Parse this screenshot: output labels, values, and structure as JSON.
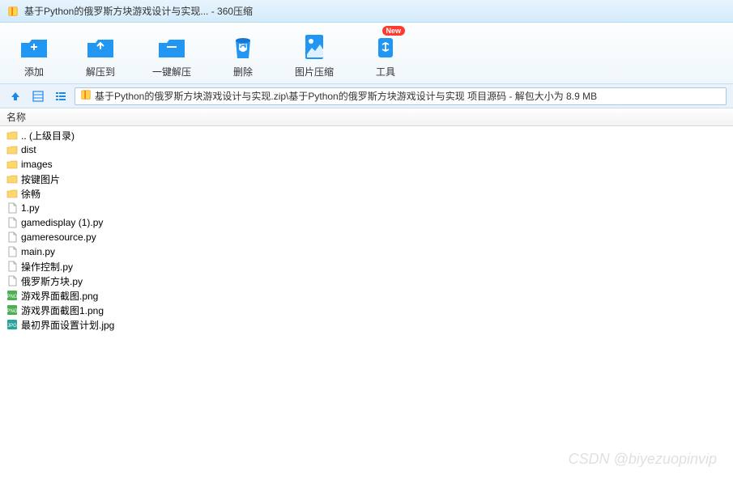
{
  "titlebar": {
    "title": "基于Python的俄罗斯方块游戏设计与实现... - 360压缩"
  },
  "toolbar": {
    "add": "添加",
    "extract_to": "解压到",
    "one_click_extract": "一键解压",
    "delete": "删除",
    "image_compress": "图片压缩",
    "tools": "工具",
    "new_badge": "New"
  },
  "pathbar": {
    "path_text": "基于Python的俄罗斯方块游戏设计与实现.zip\\基于Python的俄罗斯方块游戏设计与实现 项目源码 - 解包大小为 8.9 MB"
  },
  "columns": {
    "name": "名称"
  },
  "files": [
    {
      "icon": "folder-up",
      "name": ".. (上级目录)"
    },
    {
      "icon": "folder",
      "name": "dist"
    },
    {
      "icon": "folder",
      "name": "images"
    },
    {
      "icon": "folder",
      "name": "按键图片"
    },
    {
      "icon": "folder",
      "name": "徐畅"
    },
    {
      "icon": "file",
      "name": "1.py"
    },
    {
      "icon": "file",
      "name": "gamedisplay (1).py"
    },
    {
      "icon": "file",
      "name": "gameresource.py"
    },
    {
      "icon": "file",
      "name": "main.py"
    },
    {
      "icon": "file",
      "name": "操作控制.py"
    },
    {
      "icon": "file",
      "name": "俄罗斯方块.py"
    },
    {
      "icon": "png",
      "name": "游戏界面截图.png"
    },
    {
      "icon": "png",
      "name": "游戏界面截图1.png"
    },
    {
      "icon": "jpg",
      "name": "最初界面设置计划.jpg"
    }
  ],
  "watermark": "CSDN @biyezuopinvip"
}
